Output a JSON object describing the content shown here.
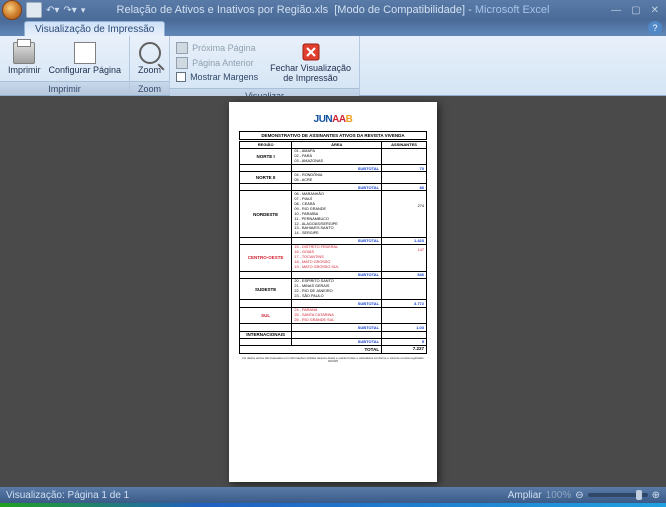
{
  "title_bar": {
    "filename": "Relação de Ativos e Inativos por Região.xls",
    "mode": "[Modo de Compatibilidade]",
    "app": "Microsoft Excel",
    "sep": " - "
  },
  "tab": {
    "name": "Visualização de Impressão"
  },
  "ribbon": {
    "print": {
      "print": "Imprimir",
      "setup": "Configurar Página",
      "group": "Imprimir"
    },
    "zoom": {
      "zoom": "Zoom",
      "group": "Zoom"
    },
    "view": {
      "next": "Próxima Página",
      "prev": "Página Anterior",
      "margins": "Mostrar Margens",
      "close_l1": "Fechar Visualização",
      "close_l2": "de Impressão",
      "group": "Visualizar"
    }
  },
  "report": {
    "logo": "JUNAAB",
    "title": "DEMONSTRATIVO DE ASSINANTES ATIVOS DA REVISTA VIVENDA",
    "headers": {
      "reg": "REGIÃO",
      "area": "ÁREA",
      "ass": "ASSINANTES"
    },
    "rows": [
      {
        "region": "NORTE I",
        "areas": "01 - AMAPÁ\n02 - PARÁ\n03 - AMAZONAS",
        "nums": "\n\n",
        "sub": "70"
      },
      {
        "region": "NORTE II",
        "areas": "04 - RONDÔNIA\n05 - ACRE",
        "nums": "\n",
        "sub": "80"
      },
      {
        "region": "NORDESTE",
        "areas": "06 - MARANHÃO\n07 - PIAUÍ\n08 - CEARÁ\n09 - RIO GRANDE\n10 - PARAÍBA\n11 - PERNAMBUCO\n12 - ALAGOAS/SERGIPE\n13 - BAHIA/ES.SANTO\n14 - SERGIPE",
        "nums": "\n\n274\n\n\n\n\n\n",
        "sub": "1.423"
      },
      {
        "region": "CENTRO-OESTE",
        "areas": "15 - DISTRITO FEDERAL\n16 - GOIÁS\n17 - TOCANTINS\n18 - MATO GROSSO\n19 - MATO GROSSO SUL",
        "nums": "147\n\n\n\n",
        "sub": "546",
        "cls": "red"
      },
      {
        "region": "SUDESTE",
        "areas": "20 - ESPÍRITO SANTO\n21 - MINAS GERAIS\n22 - RIO DE JANEIRO\n23 - SÃO PAULO",
        "nums": "\n\n\n",
        "sub": "3.772"
      },
      {
        "region": "SUL",
        "areas": "24 - PARANÁ\n25 - SANTA CATARINA\n26 - RIO GRANDE SUL",
        "nums": "\n\n",
        "sub": "1.03",
        "cls": "red"
      },
      {
        "region": "INTERNACIONAIS",
        "areas": "",
        "nums": "",
        "sub": "5"
      }
    ],
    "total_label": "TOTAL",
    "total": "7.227",
    "sub_label": "SUBTOTAL",
    "footnote": "Os dados acima são baseados em informações obtidas através desta e outras fontes e calculados conforme o total de receita registrado 00/00/0"
  },
  "status": {
    "page": "Visualização: Página 1 de 1",
    "zoom_label": "Ampliar",
    "zoom_val": "100%"
  }
}
